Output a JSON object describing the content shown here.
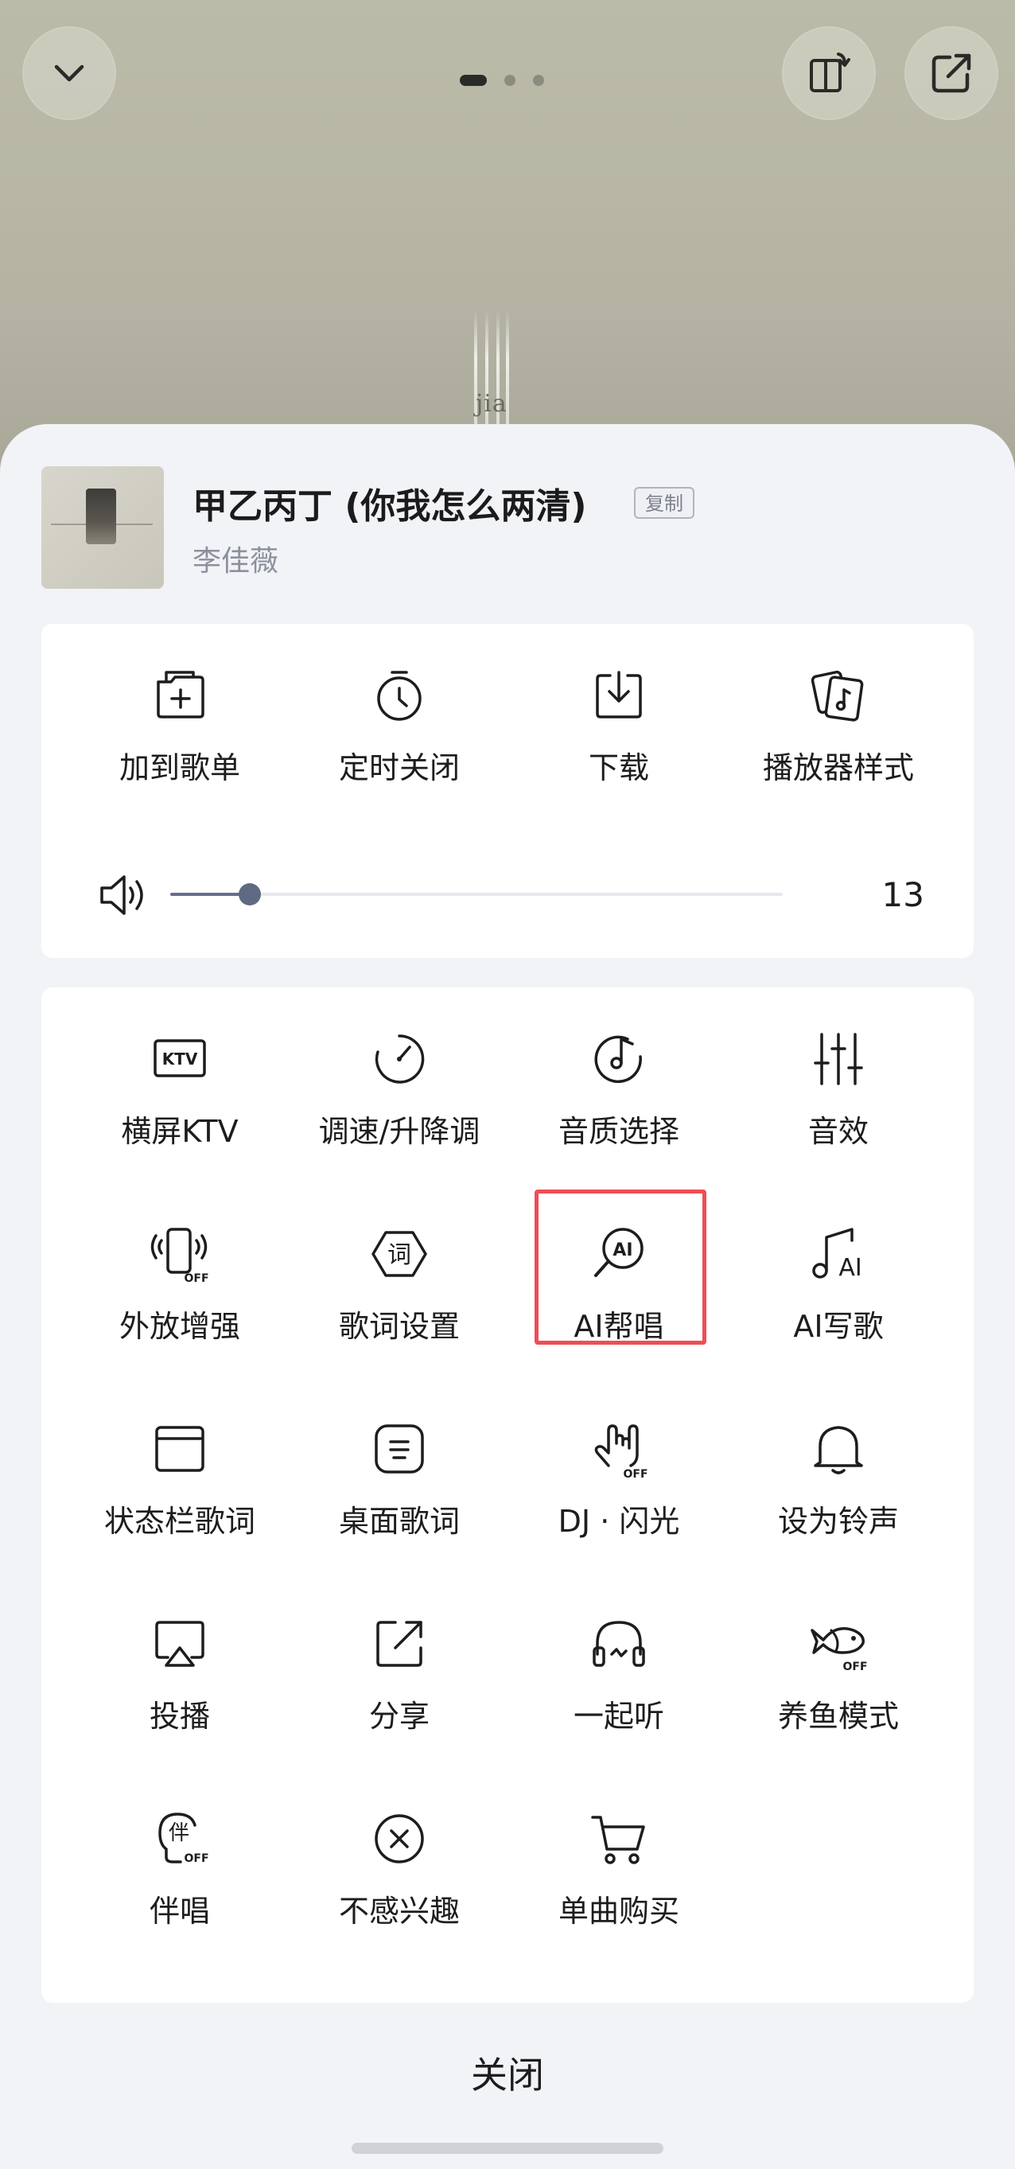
{
  "song": {
    "title": "甲乙丙丁 (你我怎么两清)",
    "artist": "李佳薇",
    "copy_label": "复制"
  },
  "background": {
    "album_text": "jia"
  },
  "top_bar": {
    "page_count": 3,
    "active_page": 1
  },
  "quick_actions": [
    {
      "label": "加到歌单",
      "icon": "add-to-playlist-icon"
    },
    {
      "label": "定时关闭",
      "icon": "timer-icon"
    },
    {
      "label": "下载",
      "icon": "download-icon"
    },
    {
      "label": "播放器样式",
      "icon": "player-style-icon"
    }
  ],
  "volume": {
    "value": "13",
    "level_percent": 13,
    "icon": "speaker-icon"
  },
  "actions": [
    {
      "label": "横屏KTV",
      "icon": "ktv-icon"
    },
    {
      "label": "调速/升降调",
      "icon": "speed-pitch-icon"
    },
    {
      "label": "音质选择",
      "icon": "sound-quality-icon"
    },
    {
      "label": "音效",
      "icon": "equalizer-icon"
    },
    {
      "label": "外放增强",
      "icon": "speaker-boost-icon"
    },
    {
      "label": "歌词设置",
      "icon": "lyrics-settings-icon"
    },
    {
      "label": "AI帮唱",
      "icon": "ai-sing-icon"
    },
    {
      "label": "AI写歌",
      "icon": "ai-write-song-icon"
    },
    {
      "label": "状态栏歌词",
      "icon": "statusbar-lyrics-icon"
    },
    {
      "label": "桌面歌词",
      "icon": "desktop-lyrics-icon"
    },
    {
      "label": "DJ · 闪光",
      "icon": "dj-flash-icon"
    },
    {
      "label": "设为铃声",
      "icon": "bell-icon"
    },
    {
      "label": "投播",
      "icon": "cast-icon"
    },
    {
      "label": "分享",
      "icon": "share-icon"
    },
    {
      "label": "一起听",
      "icon": "listen-together-icon"
    },
    {
      "label": "养鱼模式",
      "icon": "fish-mode-icon"
    },
    {
      "label": "伴唱",
      "icon": "accompany-icon"
    },
    {
      "label": "不感兴趣",
      "icon": "not-interested-icon"
    },
    {
      "label": "单曲购买",
      "icon": "cart-icon"
    }
  ],
  "close_label": "关闭",
  "colors": {
    "sheet_bg": "#f2f3f7",
    "card_bg": "#ffffff",
    "highlight": "#ef4d55",
    "slider": "#5e6a82"
  }
}
